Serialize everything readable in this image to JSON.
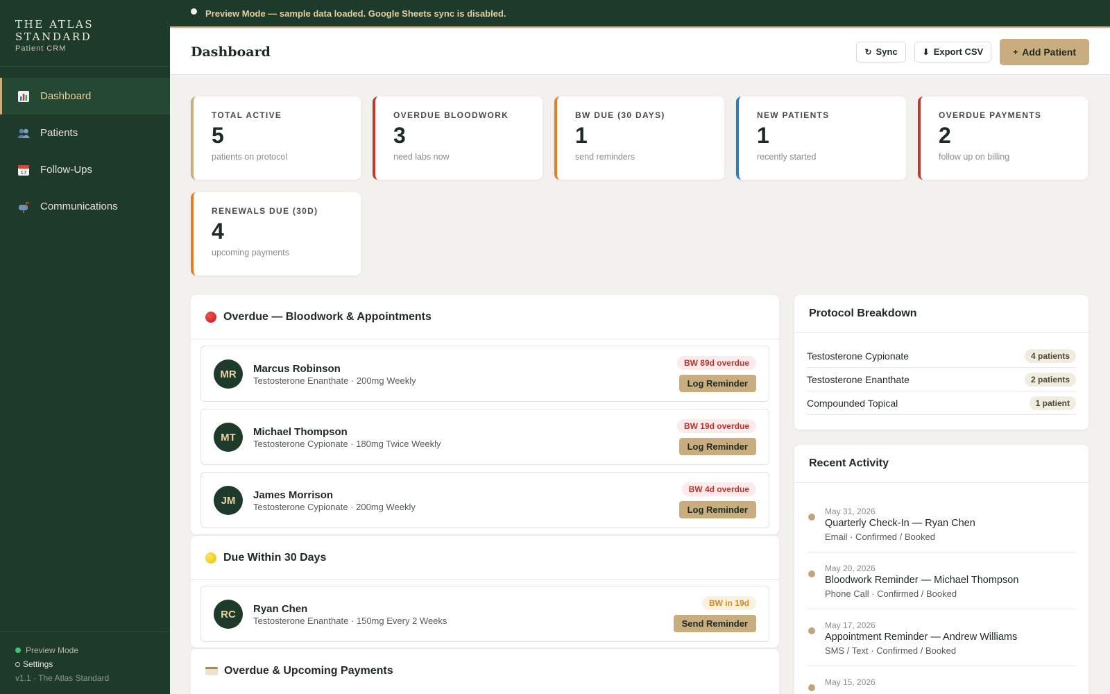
{
  "brand": {
    "title_line1": "THE ATLAS",
    "title_line2": "STANDARD",
    "subtitle": "Patient CRM"
  },
  "sidebar": {
    "items": [
      {
        "label": "Dashboard",
        "icon": "chart-icon",
        "active": true
      },
      {
        "label": "Patients",
        "icon": "people-icon",
        "active": false
      },
      {
        "label": "Follow-Ups",
        "icon": "calendar-icon",
        "active": false
      },
      {
        "label": "Communications",
        "icon": "mailbox-icon",
        "active": false
      }
    ],
    "footer": {
      "status": "Preview Mode",
      "settings": "Settings",
      "version": "v1.1 · The Atlas Standard"
    }
  },
  "banner": {
    "text": "Preview Mode — sample data loaded. Google Sheets sync is disabled."
  },
  "header": {
    "title": "Dashboard",
    "sync_label": "Sync",
    "export_label": "Export CSV",
    "add_label": "Add Patient"
  },
  "stats": [
    {
      "label": "TOTAL ACTIVE",
      "value": "5",
      "sub": "patients on protocol",
      "accent": "#c9ad7e"
    },
    {
      "label": "OVERDUE BLOODWORK",
      "value": "3",
      "sub": "need labs now",
      "accent": "#c0392b"
    },
    {
      "label": "BW DUE (30 DAYS)",
      "value": "1",
      "sub": "send reminders",
      "accent": "#e67e22"
    },
    {
      "label": "NEW PATIENTS",
      "value": "1",
      "sub": "recently started",
      "accent": "#2e7bbf"
    },
    {
      "label": "OVERDUE PAYMENTS",
      "value": "2",
      "sub": "follow up on billing",
      "accent": "#c0392b"
    },
    {
      "label": "RENEWALS DUE (30D)",
      "value": "4",
      "sub": "upcoming payments",
      "accent": "#e67e22"
    }
  ],
  "overdue_section": {
    "title": "Overdue — Bloodwork & Appointments",
    "patients": [
      {
        "initials": "MR",
        "name": "Marcus Robinson",
        "protocol": "Testosterone Enanthate · 200mg Weekly",
        "badge": "BW 89d overdue",
        "action": "Log Reminder"
      },
      {
        "initials": "MT",
        "name": "Michael Thompson",
        "protocol": "Testosterone Cypionate · 180mg Twice Weekly",
        "badge": "BW 19d overdue",
        "action": "Log Reminder"
      },
      {
        "initials": "JM",
        "name": "James Morrison",
        "protocol": "Testosterone Cypionate · 200mg Weekly",
        "badge": "BW 4d overdue",
        "action": "Log Reminder"
      }
    ]
  },
  "due_section": {
    "title": "Due Within 30 Days",
    "patients": [
      {
        "initials": "RC",
        "name": "Ryan Chen",
        "protocol": "Testosterone Enanthate · 150mg Every 2 Weeks",
        "badge": "BW in 19d",
        "action": "Send Reminder"
      }
    ]
  },
  "payments_section": {
    "title": "Overdue & Upcoming Payments"
  },
  "protocol_breakdown": {
    "title": "Protocol Breakdown",
    "rows": [
      {
        "name": "Testosterone Cypionate",
        "count": "4 patients"
      },
      {
        "name": "Testosterone Enanthate",
        "count": "2 patients"
      },
      {
        "name": "Compounded Topical",
        "count": "1 patient"
      }
    ]
  },
  "recent_activity": {
    "title": "Recent Activity",
    "items": [
      {
        "date": "May 31, 2026",
        "title": "Quarterly Check-In — Ryan Chen",
        "sub": "Email · Confirmed / Booked"
      },
      {
        "date": "May 20, 2026",
        "title": "Bloodwork Reminder — Michael Thompson",
        "sub": "Phone Call · Confirmed / Booked"
      },
      {
        "date": "May 17, 2026",
        "title": "Appointment Reminder — Andrew Williams",
        "sub": "SMS / Text · Confirmed / Booked"
      },
      {
        "date": "May 15, 2026",
        "title": "",
        "sub": ""
      }
    ]
  }
}
